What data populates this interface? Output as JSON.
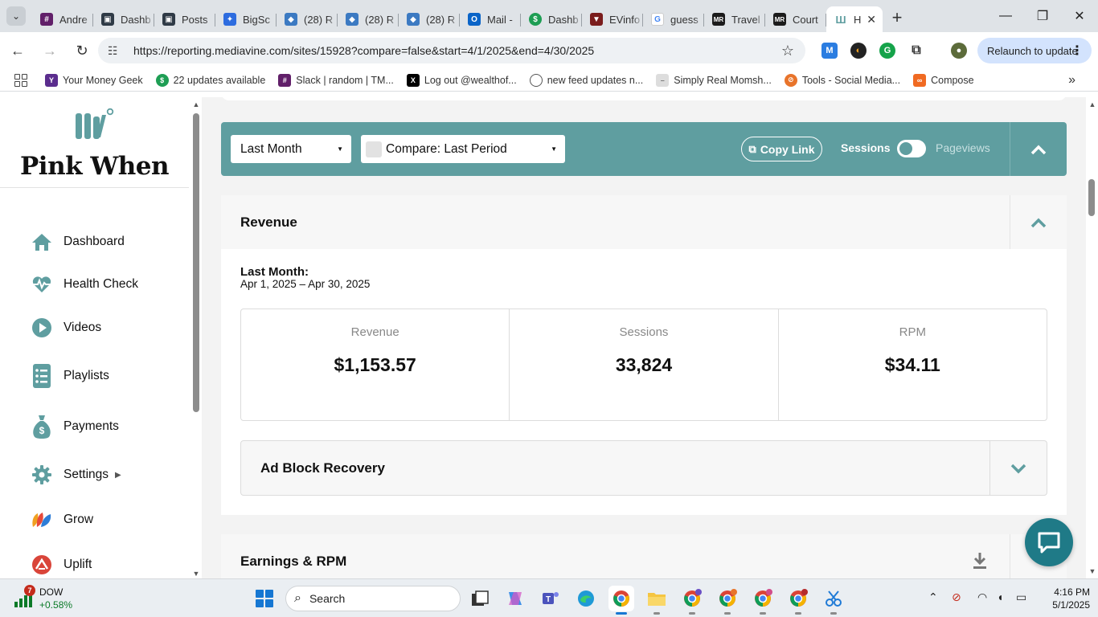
{
  "browser": {
    "tabs": [
      {
        "title": "Andre",
        "icon": "slack-icon",
        "color": "#611f69"
      },
      {
        "title": "Dashb",
        "icon": "wp-dashboard-icon",
        "color": "#2f3a46"
      },
      {
        "title": "Posts",
        "icon": "wp-dashboard-icon",
        "color": "#2f3a46"
      },
      {
        "title": "BigSc",
        "icon": "bigscoots-icon",
        "color": "#2d6cdf"
      },
      {
        "title": "(28) R",
        "icon": "cube-icon",
        "color": "#3c7ac2"
      },
      {
        "title": "(28) R",
        "icon": "cube-icon",
        "color": "#3c7ac2"
      },
      {
        "title": "(28) R",
        "icon": "cube-icon",
        "color": "#3c7ac2"
      },
      {
        "title": "Mail -",
        "icon": "outlook-icon",
        "color": "#0a64c8"
      },
      {
        "title": "Dashb",
        "icon": "dollar-icon",
        "color": "#1e9e54"
      },
      {
        "title": "EVinfo",
        "icon": "shield-icon",
        "color": "#7a1c1c"
      },
      {
        "title": "guess",
        "icon": "google-icon",
        "color": "#4285f4"
      },
      {
        "title": "Travel",
        "icon": "mr-icon",
        "color": "#1b1b1b"
      },
      {
        "title": "Court",
        "icon": "mr-icon",
        "color": "#1b1b1b"
      },
      {
        "title": "H",
        "icon": "mediavine-icon",
        "color": "#5f9ea0",
        "active": true
      }
    ],
    "url": "https://reporting.mediavine.com/sites/15928?compare=false&start=4/1/2025&end=4/30/2025",
    "relaunch_label": "Relaunch to update",
    "bookmarks": [
      {
        "label": "Your Money Geek",
        "icon": "ymg-icon",
        "color": "#5b2d8e"
      },
      {
        "label": "22 updates available",
        "icon": "dollar-icon",
        "color": "#1e9e54"
      },
      {
        "label": "Slack | random | TM...",
        "icon": "slack-icon",
        "color": "#611f69"
      },
      {
        "label": "Log out @wealthof...",
        "icon": "x-icon",
        "color": "#000000"
      },
      {
        "label": "new feed updates n...",
        "icon": "globe-icon",
        "color": "#555555"
      },
      {
        "label": "Simply Real Momsh...",
        "icon": "srm-icon",
        "color": "#aaaaaa"
      },
      {
        "label": "Tools - Social Media...",
        "icon": "tools-icon",
        "color": "#e8742b"
      },
      {
        "label": "Compose",
        "icon": "compose-icon",
        "color": "#f06a22"
      }
    ]
  },
  "sidebar": {
    "site_name": "Pink When",
    "items": [
      {
        "label": "Dashboard",
        "icon": "home-icon"
      },
      {
        "label": "Health Check",
        "icon": "heartbeat-icon"
      },
      {
        "label": "Videos",
        "icon": "play-icon"
      },
      {
        "label": "Playlists",
        "icon": "playlist-icon"
      },
      {
        "label": "Payments",
        "icon": "money-bag-icon"
      },
      {
        "label": "Settings",
        "icon": "gear-icon"
      },
      {
        "label": "Grow",
        "icon": "grow-icon"
      },
      {
        "label": "Uplift",
        "icon": "uplift-icon"
      }
    ]
  },
  "filters": {
    "period_value": "Last Month",
    "compare_value": "Compare: Last Period",
    "copy_link_label": "Copy Link",
    "sessions_label": "Sessions",
    "pageviews_label": "Pageviews",
    "accent_color": "#5f9ea0"
  },
  "revenue": {
    "title": "Revenue",
    "period_label": "Last Month:",
    "period_range": "Apr 1, 2025 – Apr 30, 2025",
    "metrics": [
      {
        "label": "Revenue",
        "value": "$1,153.57"
      },
      {
        "label": "Sessions",
        "value": "33,824"
      },
      {
        "label": "RPM",
        "value": "$34.11"
      }
    ],
    "ad_block_title": "Ad Block Recovery"
  },
  "earnings": {
    "title": "Earnings & RPM"
  },
  "taskbar": {
    "ticker_name": "DOW",
    "ticker_change": "+0.58%",
    "ticker_badge": "7",
    "search_placeholder": "Search",
    "time": "4:16 PM",
    "date": "5/1/2025"
  }
}
